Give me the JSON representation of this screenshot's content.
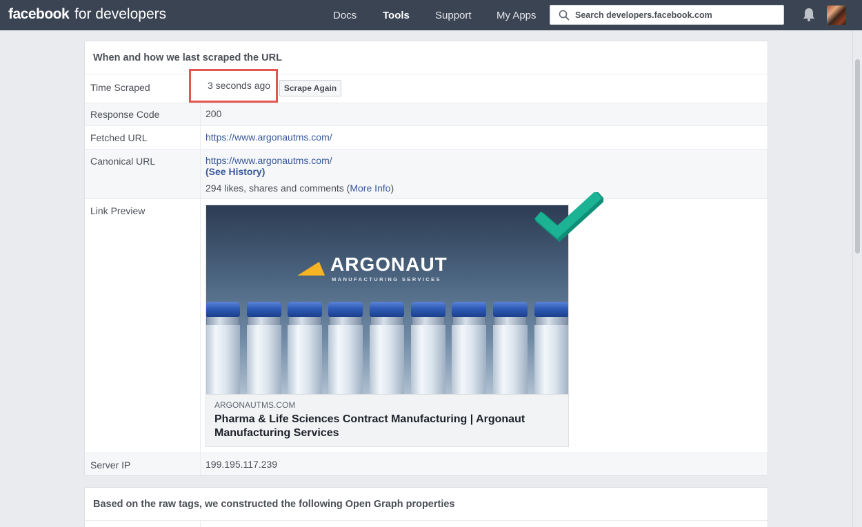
{
  "nav": {
    "brand_bold": "facebook",
    "brand_rest": "for developers",
    "links": [
      "Docs",
      "Tools",
      "Support",
      "My Apps"
    ],
    "search_placeholder": "Search developers.facebook.com"
  },
  "panel1": {
    "title": "When and how we last scraped the URL",
    "rows": {
      "time_scraped": {
        "label": "Time Scraped",
        "value": "3 seconds ago",
        "button": "Scrape Again"
      },
      "response_code": {
        "label": "Response Code",
        "value": "200"
      },
      "fetched_url": {
        "label": "Fetched URL",
        "value": "https://www.argonautms.com/"
      },
      "canonical_url": {
        "label": "Canonical URL",
        "value": "https://www.argonautms.com/",
        "history": "(See History)",
        "engagement_prefix": "294 likes, shares and comments (",
        "more_info": "More Info",
        "engagement_suffix": ")"
      },
      "link_preview": {
        "label": "Link Preview",
        "logo_word": "ARGONAUT",
        "logo_sub": "MANUFACTURING SERVICES",
        "domain": "ARGONAUTMS.COM",
        "title": "Pharma & Life Sciences Contract Manufacturing | Argonaut Manufacturing Services"
      },
      "server_ip": {
        "label": "Server IP",
        "value": "199.195.117.239"
      }
    }
  },
  "panel2": {
    "title": "Based on the raw tags, we constructed the following Open Graph properties"
  },
  "colors": {
    "topbar": "#3b4453",
    "link": "#365899",
    "highlight_box": "#e3564f",
    "checkmark": "#1bb394",
    "logo_accent": "#f6b322"
  },
  "icons": [
    "search-icon",
    "bell-icon",
    "checkmark-icon"
  ]
}
